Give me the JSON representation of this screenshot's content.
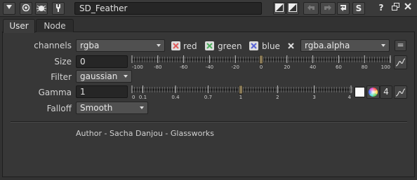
{
  "node_name": "SD_Feather",
  "tabs": [
    "User",
    "Node"
  ],
  "channels": {
    "label": "channels",
    "value": "rgba",
    "red": "red",
    "green": "green",
    "blue": "blue",
    "alpha_value": "rgba.alpha",
    "link_btn": "="
  },
  "size": {
    "label": "Size",
    "value": "0",
    "ticks": [
      "-100",
      "-80",
      "-60",
      "-40",
      "-20",
      "0",
      "20",
      "40",
      "60",
      "80",
      "100"
    ],
    "slider_value": 0
  },
  "filter": {
    "label": "Filter",
    "value": "gaussian"
  },
  "gamma": {
    "label": "Gamma",
    "value": "1",
    "ticks": [
      "0",
      "0.1",
      "0.4",
      "0.7",
      "1",
      "2",
      "3",
      "4"
    ],
    "slider_value": 1,
    "channel_count": "4"
  },
  "falloff": {
    "label": "Falloff",
    "value": "Smooth"
  },
  "credit": "Author - Sacha Danjou - Glassworks",
  "colors": {
    "red": "#e05a5a",
    "green": "#4cae5c",
    "blue": "#5a64d6",
    "white": "#dcdcdc"
  },
  "icons": [
    "eye-icon",
    "circle-icon",
    "bug-icon",
    "wrench-icon",
    "checker-icon",
    "checker-icon",
    "undo-icon",
    "redo-icon",
    "revert-icon",
    "s-icon",
    "help-icon",
    "float-icon",
    "close-icon",
    "curve-icon",
    "color-wheel-icon"
  ]
}
